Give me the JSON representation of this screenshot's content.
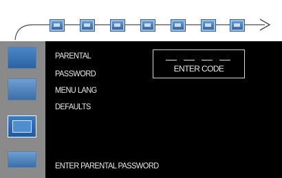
{
  "top_icons": [
    "audio-icon",
    "video-icon",
    "subtitle-icon",
    "language-icon",
    "system-icon",
    "rating-icon",
    "misc-icon"
  ],
  "side_icons": [
    "language-setup-icon",
    "speaker-setup-icon",
    "parental-setup-icon",
    "preference-icon"
  ],
  "menu": {
    "items": [
      {
        "label": "PARENTAL"
      },
      {
        "label": "PASSWORD"
      },
      {
        "label": "MENU LANG"
      },
      {
        "label": "DEFAULTS"
      }
    ]
  },
  "code_entry": {
    "slots": [
      "_",
      "_",
      "_",
      "_"
    ],
    "label": "ENTER CODE"
  },
  "status_text": "ENTER PARENTAL PASSWORD",
  "colors": {
    "panel": "#000000",
    "sidebar": "#8a8a8a",
    "icon": "#3b6ea8"
  }
}
